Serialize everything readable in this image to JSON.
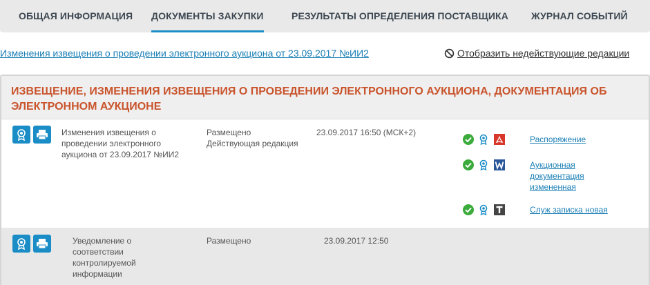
{
  "tabs": [
    {
      "label": "ОБЩАЯ ИНФОРМАЦИЯ",
      "active": false
    },
    {
      "label": "ДОКУМЕНТЫ ЗАКУПКИ",
      "active": true
    },
    {
      "label": "РЕЗУЛЬТАТЫ ОПРЕДЕЛЕНИЯ ПОСТАВЩИКА",
      "active": false
    },
    {
      "label": "ЖУРНАЛ СОБЫТИЙ",
      "active": false
    }
  ],
  "notice_link": "Изменения извещения о проведении электронного аукциона от 23.09.2017 №ИИ2",
  "toggle_inactive": "Отобразить недействующие редакции",
  "panel": {
    "title": "ИЗВЕЩЕНИЕ, ИЗМЕНЕНИЯ ИЗВЕЩЕНИЯ О ПРОВЕДЕНИИ ЭЛЕКТРОННОГО АУКЦИОНА, ДОКУМЕНТАЦИЯ ОБ ЭЛЕКТРОННОМ АУКЦИОНЕ",
    "rows": [
      {
        "name": "Изменения извещения о проведении электронного аукциона от 23.09.2017 №ИИ2",
        "status_line1": "Размещено",
        "status_line2": "Действующая редакция",
        "date": "23.09.2017 16:50 (МСК+2)",
        "files": [
          {
            "label": "Распоряжение",
            "type": "pdf-icon"
          },
          {
            "label": "Аукционная документация измененная",
            "type": "word-icon"
          },
          {
            "label": "Служ записка новая",
            "type": "text-file-icon"
          }
        ]
      },
      {
        "name": "Уведомление о соответствии контролируемой информации",
        "status_line1": "Размещено",
        "date": "23.09.2017 12:50"
      }
    ]
  },
  "colors": {
    "accent": "#1b8dc6",
    "title": "#c9542c",
    "link": "#1b7fb5",
    "check": "#3bab3b",
    "pdf": "#d8382b",
    "word": "#2a5699"
  }
}
